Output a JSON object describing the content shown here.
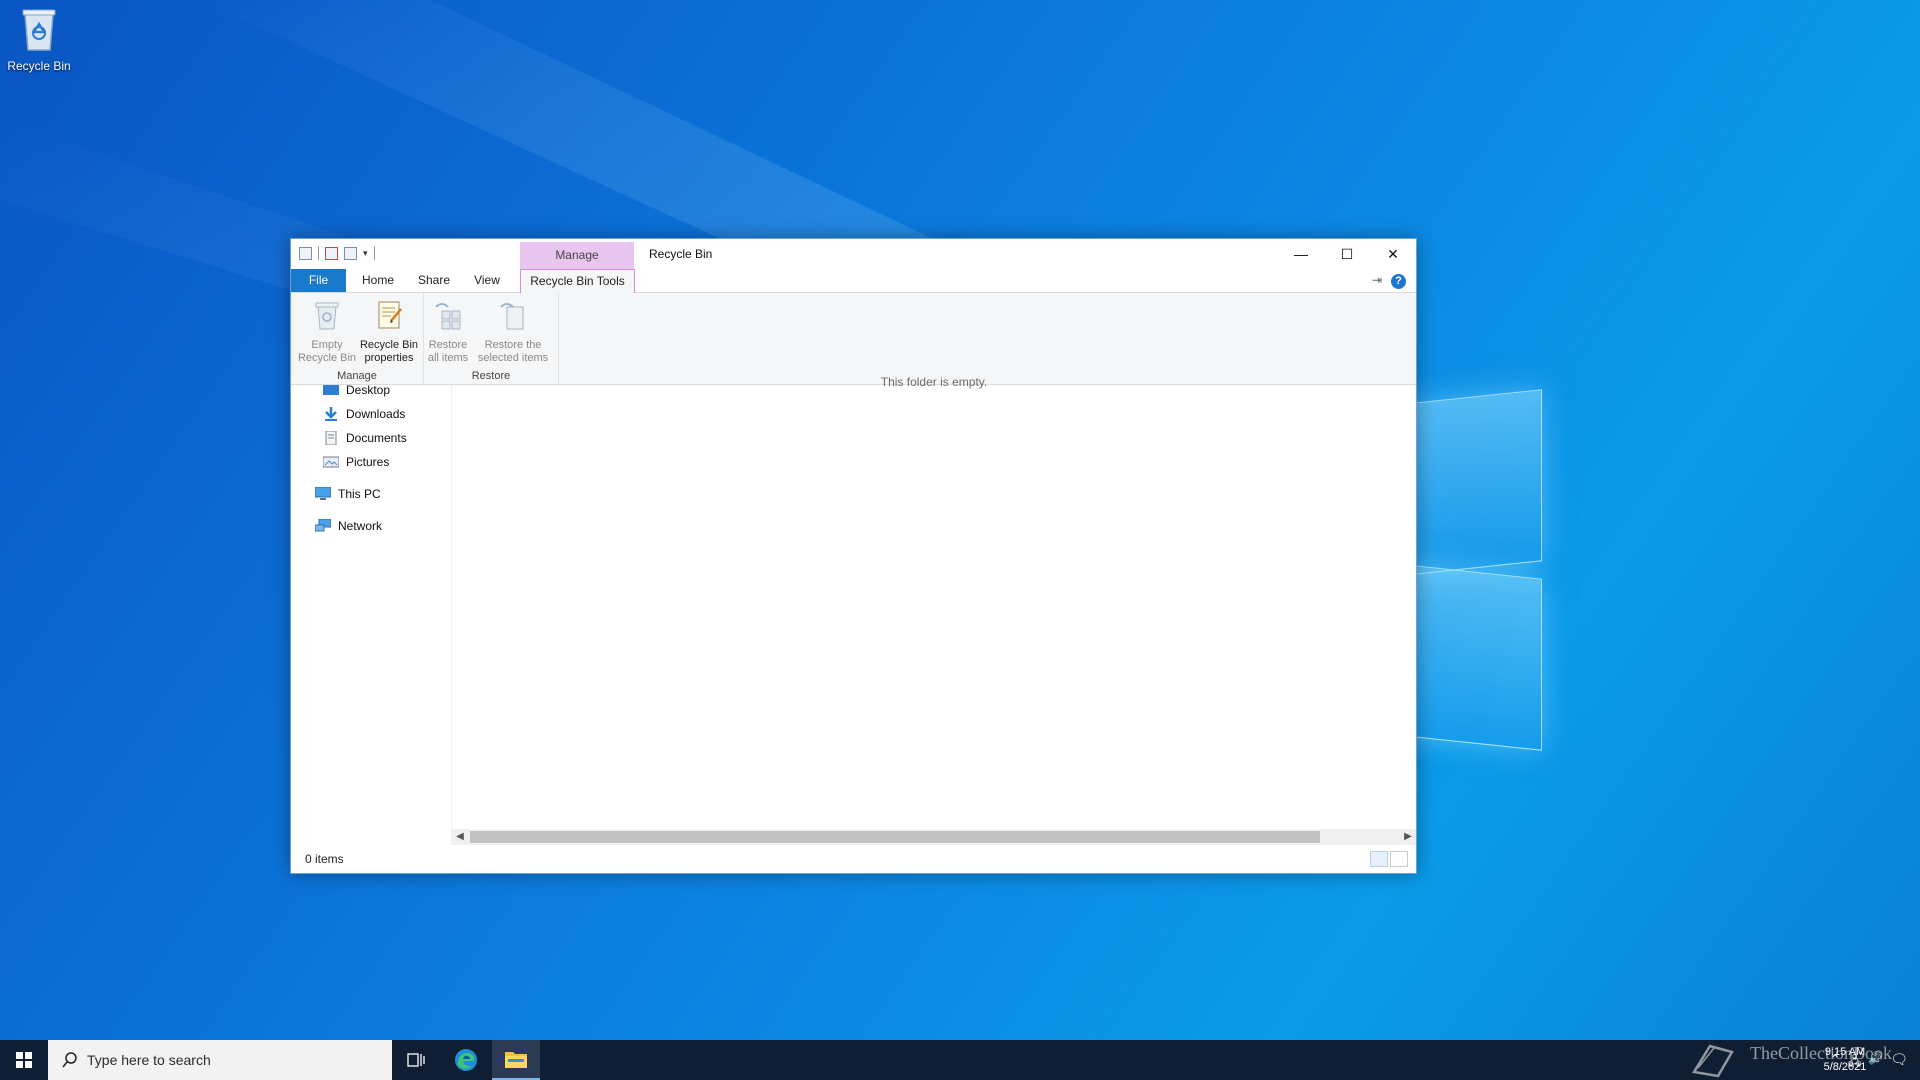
{
  "desktop": {
    "icons": [
      {
        "label": "Recycle Bin",
        "icon": "recycle-bin-icon"
      }
    ]
  },
  "window": {
    "title": "Recycle Bin",
    "context_tab": "Manage",
    "quick_access_dropdown": "▾",
    "controls": {
      "minimize": "—",
      "maximize": "☐",
      "close": "✕"
    },
    "tabs": [
      "File",
      "Home",
      "Share",
      "View",
      "Recycle Bin Tools"
    ],
    "help_label": "?",
    "ribbon": {
      "groups": [
        {
          "label": "Manage",
          "buttons": [
            {
              "label_line1": "Empty",
              "label_line2": "Recycle Bin",
              "icon": "empty-recycle-bin-icon",
              "enabled": false
            },
            {
              "label_line1": "Recycle Bin",
              "label_line2": "properties",
              "icon": "properties-icon",
              "enabled": true
            }
          ]
        },
        {
          "label": "Restore",
          "buttons": [
            {
              "label_line1": "Restore",
              "label_line2": "all items",
              "icon": "restore-all-icon",
              "enabled": false
            },
            {
              "label_line1": "Restore the",
              "label_line2": "selected items",
              "icon": "restore-selected-icon",
              "enabled": false
            }
          ]
        }
      ]
    },
    "nav": {
      "items": [
        {
          "label": "Desktop",
          "icon": "desktop-icon",
          "pinned": true
        },
        {
          "label": "Downloads",
          "icon": "downloads-icon",
          "pinned": true
        },
        {
          "label": "Documents",
          "icon": "documents-icon",
          "pinned": true
        },
        {
          "label": "Pictures",
          "icon": "pictures-icon",
          "pinned": true
        },
        {
          "label": "This PC",
          "icon": "this-pc-icon",
          "pinned": false
        },
        {
          "label": "Network",
          "icon": "network-icon",
          "pinned": false
        }
      ]
    },
    "content": {
      "empty_message": "This folder is empty."
    },
    "status": {
      "item_count": "0 items"
    }
  },
  "taskbar": {
    "search_placeholder": "Type here to search",
    "pinned": [
      "task-view-icon",
      "edge-icon",
      "file-explorer-icon"
    ],
    "clock": {
      "time": "9:15 AM",
      "date": "5/8/2021"
    },
    "watermark": "TheCollectionBook"
  },
  "colors": {
    "accent": "#1979ca",
    "context_tab": "#e9c6f0",
    "taskbar": "#101e33"
  }
}
